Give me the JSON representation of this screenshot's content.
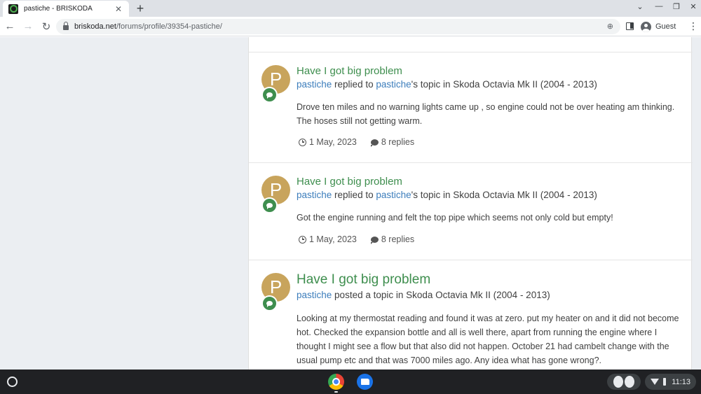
{
  "browser": {
    "tab_title": "pastiche - BRISKODA",
    "tab_close": "✕",
    "new_tab": "+",
    "url_host": "briskoda.net",
    "url_path": "/forums/profile/39354-pastiche/",
    "profile_label": "Guest"
  },
  "activities": [
    {
      "title": "Have I got big problem",
      "author": "pastiche",
      "action": " replied to ",
      "topic_owner": "pastiche",
      "topic_suffix": "'s topic in Skoda Octavia Mk II (2004 - 2013)",
      "body": "Drove ten miles and no warning lights came up , so engine could not be over heating am thinking. The hoses still not getting warm.",
      "date": "1 May, 2023",
      "replies": "8 replies"
    },
    {
      "title": "Have I got big problem",
      "author": "pastiche",
      "action": " replied to ",
      "topic_owner": "pastiche",
      "topic_suffix": "'s topic in Skoda Octavia Mk II (2004 - 2013)",
      "body": "Got the engine running and felt the top pipe which seems not only cold but empty!",
      "date": "1 May, 2023",
      "replies": "8 replies"
    },
    {
      "title": "Have I got big problem",
      "author": "pastiche",
      "action": " posted a topic in Skoda Octavia Mk II (2004 - 2013)",
      "body": "Looking at my thermostat reading and found it was at zero. put my heater on and it did not become hot. Checked the expansion bottle and all is well there, apart from running the engine where I thought I might see a flow but that also did not happen. October 21 had cambelt change with the usual pump etc and that was 7000 miles ago. Any idea what has gone wrong?."
    }
  ],
  "avatar_letter": "P",
  "shelf": {
    "time": "11:13"
  },
  "colors": {
    "accent_green": "#3e8e4e",
    "link_blue": "#3d7ebc",
    "avatar_gold": "#c8a45c"
  }
}
